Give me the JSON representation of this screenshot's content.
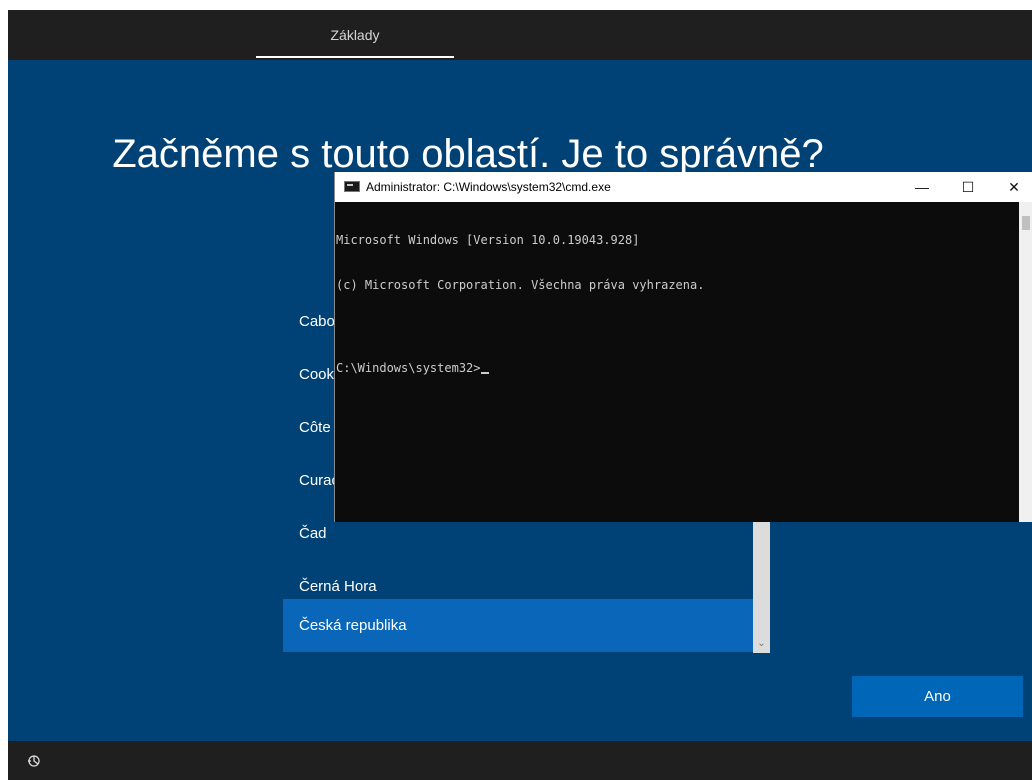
{
  "top_bar": {
    "tab_label": "Základy"
  },
  "main": {
    "heading": "Začněme s touto oblastí. Je to správně?",
    "regions": [
      {
        "label": "Cabo",
        "selected": false
      },
      {
        "label": "Cook",
        "selected": false
      },
      {
        "label": "Côte",
        "selected": false
      },
      {
        "label": "Curaç",
        "selected": false
      },
      {
        "label": "Čad",
        "selected": false
      },
      {
        "label": "Černá Hora",
        "selected": false
      },
      {
        "label": "Česká republika",
        "selected": true
      }
    ],
    "yes_button": "Ano"
  },
  "bottom_bar": {
    "accessibility_icon": "ease-of-access-icon"
  },
  "cmd_window": {
    "title": "Administrator: C:\\Windows\\system32\\cmd.exe",
    "minimize_glyph": "—",
    "maximize_glyph": "☐",
    "close_glyph": "✕",
    "lines": [
      "Microsoft Windows [Version 10.0.19043.928]",
      "(c) Microsoft Corporation. Všechna práva vyhrazena."
    ],
    "prompt": "C:\\Windows\\system32>"
  },
  "colors": {
    "background": "#004275",
    "bar": "#1f1f1f",
    "selected_item": "#0a66b8",
    "button": "#0067b8"
  }
}
